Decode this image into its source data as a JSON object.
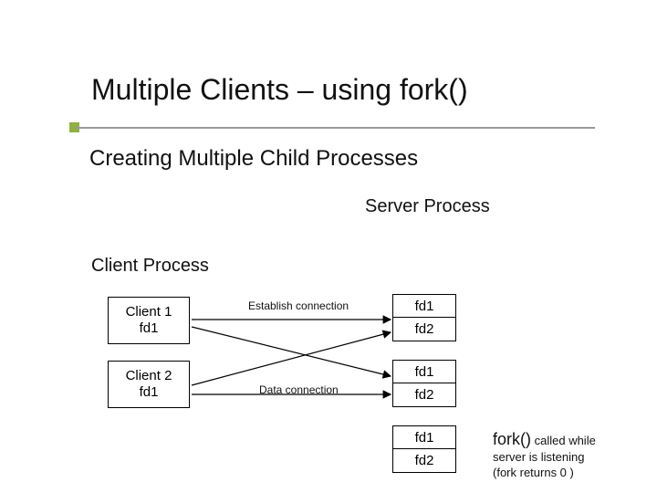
{
  "title": "Multiple Clients – using fork()",
  "subtitle": "Creating Multiple Child Processes",
  "server_label": "Server Process",
  "client_label": "Client Process",
  "clients": {
    "c1": {
      "name": "Client 1",
      "fd": "fd1"
    },
    "c2": {
      "name": "Client 2",
      "fd": "fd1"
    }
  },
  "fd_groups": {
    "g1": {
      "a": "fd1",
      "b": "fd2"
    },
    "g2": {
      "a": "fd1",
      "b": "fd2"
    },
    "g3": {
      "a": "fd1",
      "b": "fd2"
    }
  },
  "conn": {
    "establish": "Establish connection",
    "data": "Data connection"
  },
  "fork": {
    "fn": "fork()",
    "rest1": " called while",
    "line2": "server is listening",
    "line3": "(fork returns 0 )"
  }
}
